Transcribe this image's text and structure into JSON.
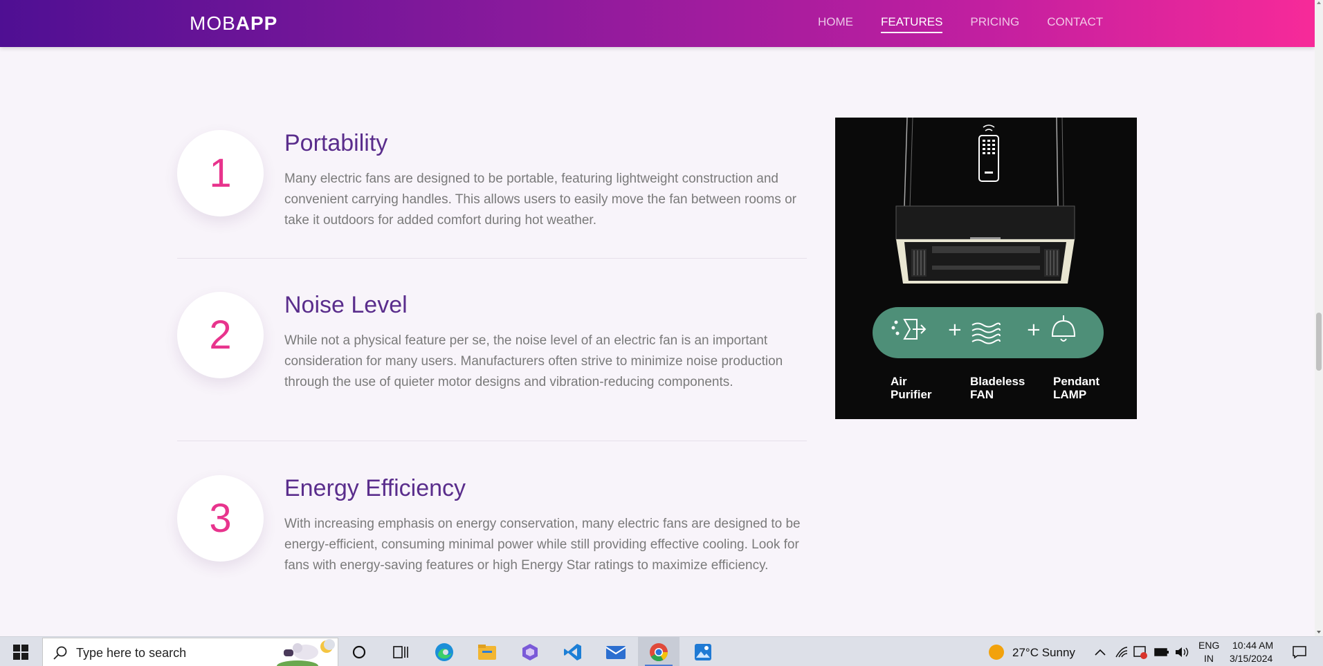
{
  "navbar": {
    "brand_light": "MOB",
    "brand_bold": "APP",
    "links": [
      {
        "label": "HOME"
      },
      {
        "label": "FEATURES"
      },
      {
        "label": "PRICING"
      },
      {
        "label": "CONTACT"
      }
    ],
    "active_link": "FEATURES"
  },
  "features": [
    {
      "number": "1",
      "title": "Portability",
      "description": "Many electric fans are designed to be portable, featuring lightweight construction and convenient carrying handles. This allows users to easily move the fan between rooms or take it outdoors for added comfort during hot weather."
    },
    {
      "number": "2",
      "title": "Noise Level",
      "description": "While not a physical feature per se, the noise level of an electric fan is an important consideration for many users. Manufacturers often strive to minimize noise production through the use of quieter motor designs and vibration-reducing components."
    },
    {
      "number": "3",
      "title": "Energy Efficiency",
      "description": "With increasing emphasis on energy conservation, many electric fans are designed to be energy-efficient, consuming minimal power while still providing effective cooling. Look for fans with energy-saving features or high Energy Star ratings to maximize efficiency."
    }
  ],
  "product_image": {
    "labels": [
      {
        "line1": "Air",
        "line2": "Purifier"
      },
      {
        "line1": "Bladeless",
        "line2": "FAN"
      },
      {
        "line1": "Pendant",
        "line2": "LAMP"
      }
    ],
    "plus": "+",
    "pill_color": "#4e8f78"
  },
  "taskbar": {
    "search_placeholder": "Type here to search",
    "weather": "27°C  Sunny",
    "language_line1": "ENG",
    "language_line2": "IN",
    "time": "10:44 AM",
    "date": "3/15/2024"
  },
  "colors": {
    "accent_pink": "#e8348d",
    "title_purple": "#5a2d8c",
    "nav_gradient_start": "#4f0f93",
    "nav_gradient_end": "#f72a99"
  }
}
